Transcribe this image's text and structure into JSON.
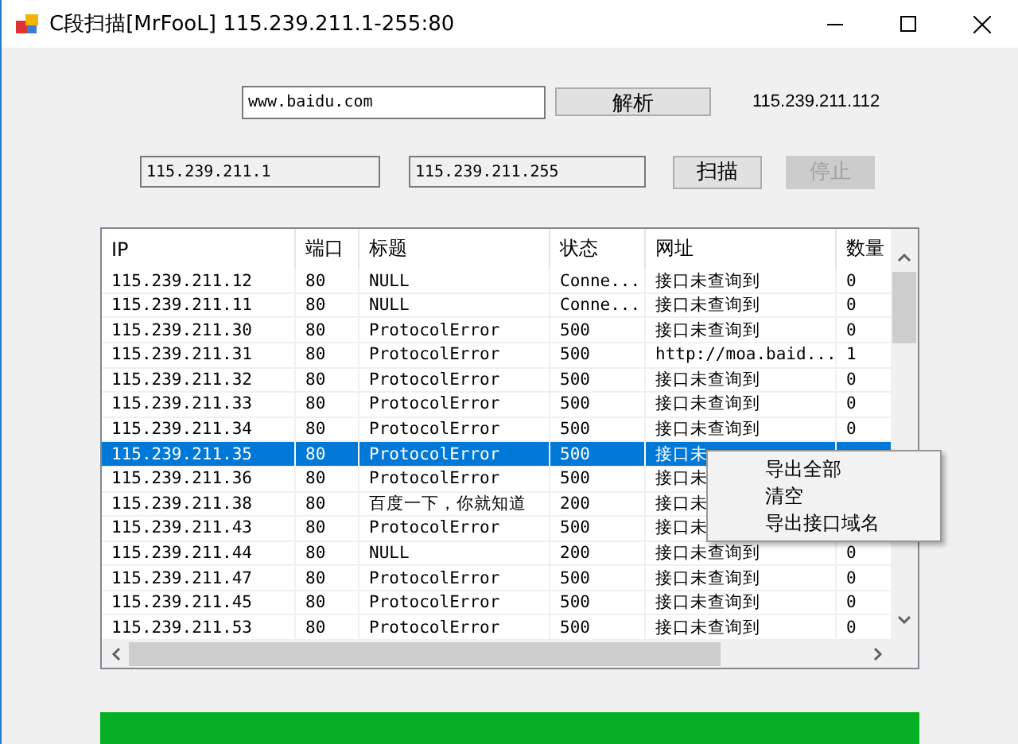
{
  "window": {
    "title": "C段扫描[MrFooL] 115.239.211.1-255:80"
  },
  "resolve": {
    "domain": "www.baidu.com",
    "button": "解析",
    "result": "115.239.211.112"
  },
  "scan": {
    "start_ip": "115.239.211.1",
    "end_ip": "115.239.211.255",
    "scan_button": {
      "label": "扫描",
      "disabled": false
    },
    "stop_button": {
      "label": "停止",
      "disabled": true
    }
  },
  "table": {
    "columns": [
      "IP",
      "端口",
      "标题",
      "状态",
      "网址",
      "数量"
    ],
    "rows": [
      {
        "cells": [
          "115.239.211.12",
          "80",
          "NULL",
          "Conne...",
          "接口未查询到",
          "0"
        ],
        "selected": false
      },
      {
        "cells": [
          "115.239.211.11",
          "80",
          "NULL",
          "Conne...",
          "接口未查询到",
          "0"
        ],
        "selected": false
      },
      {
        "cells": [
          "115.239.211.30",
          "80",
          "ProtocolError",
          "500",
          "接口未查询到",
          "0"
        ],
        "selected": false
      },
      {
        "cells": [
          "115.239.211.31",
          "80",
          "ProtocolError",
          "500",
          "http://moa.baid...",
          "1"
        ],
        "selected": false
      },
      {
        "cells": [
          "115.239.211.32",
          "80",
          "ProtocolError",
          "500",
          "接口未查询到",
          "0"
        ],
        "selected": false
      },
      {
        "cells": [
          "115.239.211.33",
          "80",
          "ProtocolError",
          "500",
          "接口未查询到",
          "0"
        ],
        "selected": false
      },
      {
        "cells": [
          "115.239.211.34",
          "80",
          "ProtocolError",
          "500",
          "接口未查询到",
          "0"
        ],
        "selected": false
      },
      {
        "cells": [
          "115.239.211.35",
          "80",
          "ProtocolError",
          "500",
          "接口未"
        ],
        "selected": true
      },
      {
        "cells": [
          "115.239.211.36",
          "80",
          "ProtocolError",
          "500",
          "接口未"
        ],
        "selected": false
      },
      {
        "cells": [
          "115.239.211.38",
          "80",
          "百度一下，你就知道",
          "200",
          "接口未"
        ],
        "selected": false
      },
      {
        "cells": [
          "115.239.211.43",
          "80",
          "ProtocolError",
          "500",
          "接口未"
        ],
        "selected": false
      },
      {
        "cells": [
          "115.239.211.44",
          "80",
          "NULL",
          "200",
          "接口未查询到",
          "0"
        ],
        "selected": false
      },
      {
        "cells": [
          "115.239.211.47",
          "80",
          "ProtocolError",
          "500",
          "接口未查询到",
          "0"
        ],
        "selected": false
      },
      {
        "cells": [
          "115.239.211.45",
          "80",
          "ProtocolError",
          "500",
          "接口未查询到",
          "0"
        ],
        "selected": false
      },
      {
        "cells": [
          "115.239.211.53",
          "80",
          "ProtocolError",
          "500",
          "接口未查询到",
          "0"
        ],
        "selected": false
      }
    ]
  },
  "context_menu": {
    "items": [
      "导出全部",
      "清空",
      "导出接口域名"
    ]
  },
  "progress": {
    "level": 1
  }
}
